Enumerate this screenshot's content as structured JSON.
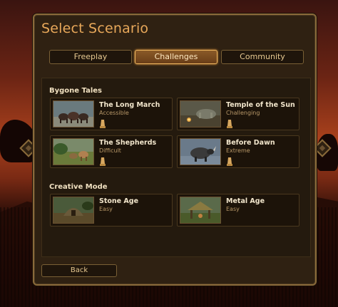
{
  "title": "Select Scenario",
  "tabs": [
    {
      "label": "Freeplay",
      "selected": false
    },
    {
      "label": "Challenges",
      "selected": true
    },
    {
      "label": "Community",
      "selected": false
    }
  ],
  "sections": [
    {
      "label": "Bygone Tales",
      "cards": [
        {
          "title": "The Long March",
          "difficulty": "Accessible",
          "thumb_icon": "mammoth-herd-icon"
        },
        {
          "title": "Temple of the Sun",
          "difficulty": "Challenging",
          "thumb_icon": "stone-temple-icon"
        },
        {
          "title": "The Shepherds",
          "difficulty": "Difficult",
          "thumb_icon": "animals-field-icon"
        },
        {
          "title": "Before Dawn",
          "difficulty": "Extreme",
          "thumb_icon": "rhino-icon"
        }
      ]
    },
    {
      "label": "Creative Mode",
      "cards": [
        {
          "title": "Stone Age",
          "difficulty": "Easy",
          "thumb_icon": "stone-hut-icon"
        },
        {
          "title": "Metal Age",
          "difficulty": "Easy",
          "thumb_icon": "thatched-hut-icon"
        }
      ]
    }
  ],
  "back_label": "Back",
  "colors": {
    "accent": "#e8a85a",
    "border": "#8a6a3a",
    "panel": "#2f2112",
    "medal": "#d8a860"
  }
}
